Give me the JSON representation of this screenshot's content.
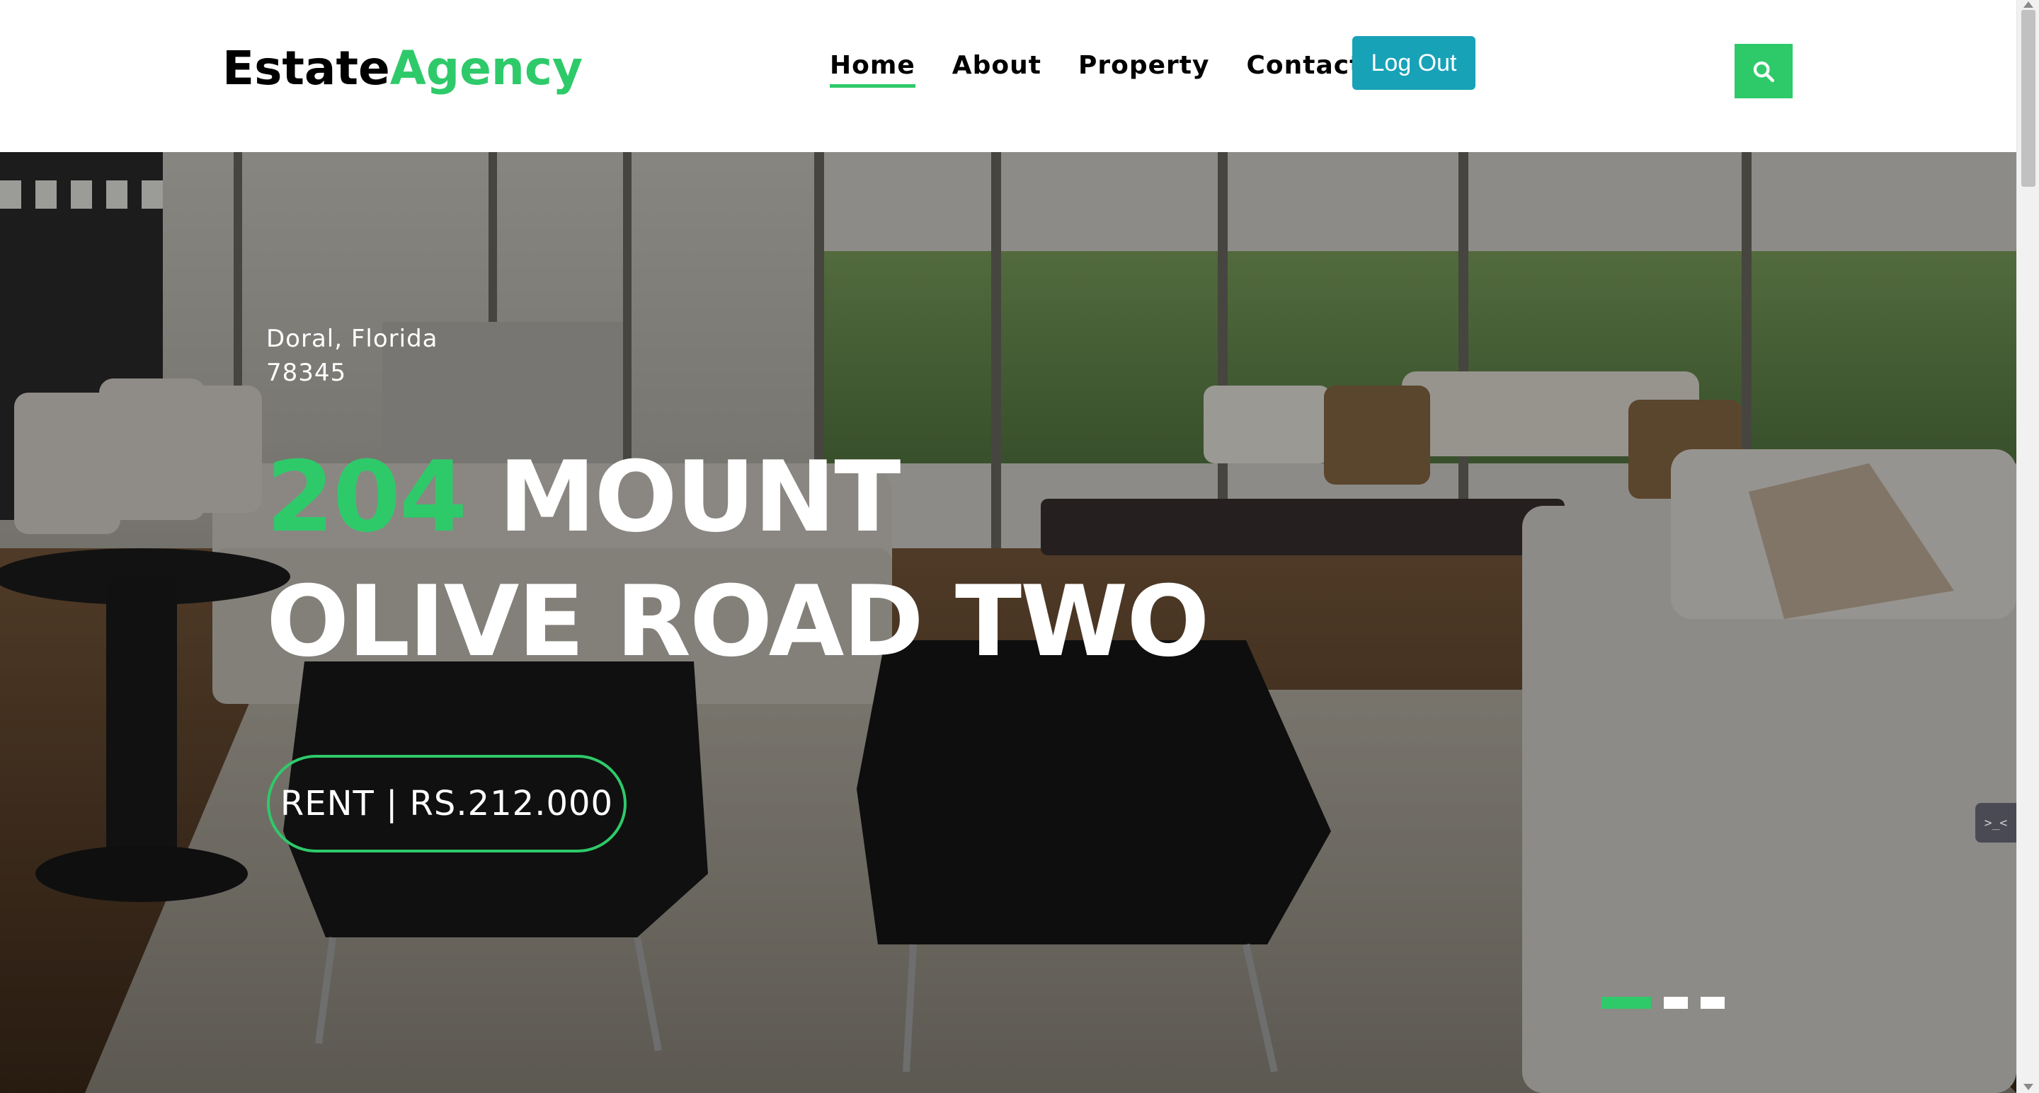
{
  "header": {
    "brand_part1": "Estate",
    "brand_part2": "Agency",
    "nav": [
      {
        "label": "Home",
        "active": true
      },
      {
        "label": "About",
        "active": false
      },
      {
        "label": "Property",
        "active": false
      },
      {
        "label": "Contact",
        "active": false
      }
    ],
    "logout_label": "Log Out",
    "search_icon": "search-icon"
  },
  "hero": {
    "location_line1": "Doral, Florida",
    "location_line2": "78345",
    "title_number": "204",
    "title_line1_rest": " MOUNT",
    "title_line2": "OLIVE ROAD TWO",
    "price_label": "RENT | RS.212.000",
    "carousel": {
      "slides": 3,
      "active_index": 0
    }
  },
  "colors": {
    "accent": "#2eca6a",
    "logout_bg": "#17a2b8"
  }
}
